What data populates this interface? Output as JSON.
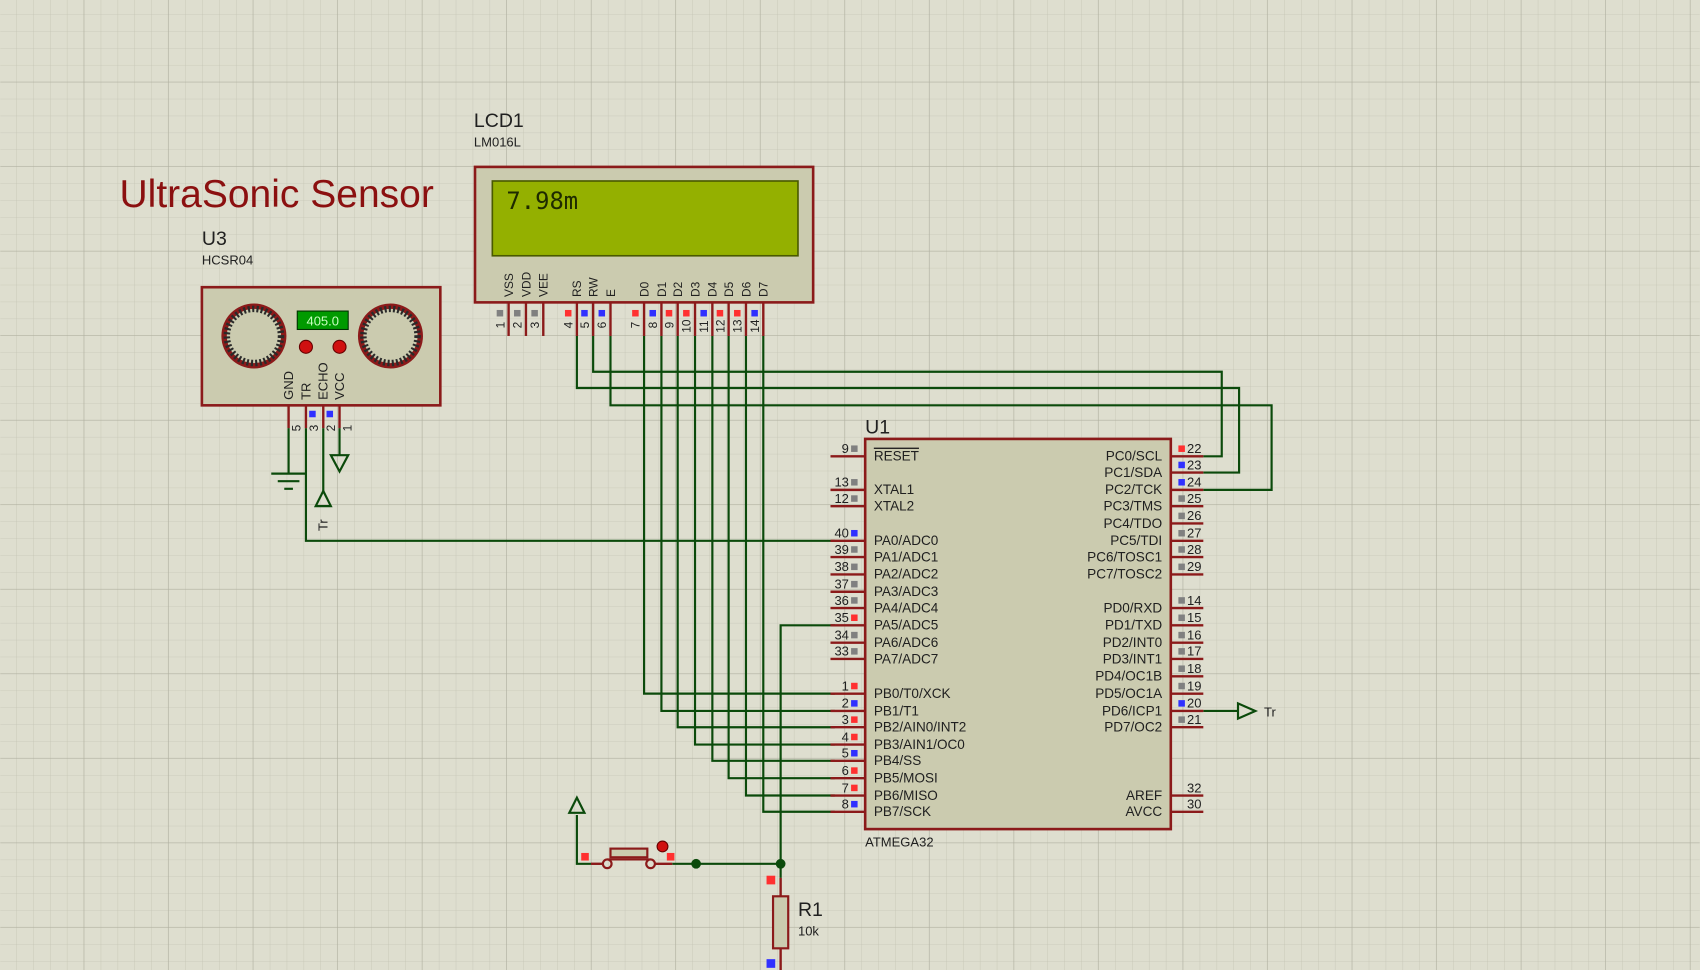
{
  "title": "UltraSonic Sensor",
  "colors": {
    "background": "#dedecf",
    "outline": "#8b1a1a",
    "wire": "#0b4a0b",
    "lcd_screen": "#94b000",
    "title": "#8b1010",
    "pin_high": "#ff3030",
    "pin_low": "#3030ff",
    "pin_float": "#808080"
  },
  "sensor": {
    "ref": "U3",
    "part": "HCSR04",
    "display_value": "405.0",
    "pins": [
      {
        "name": "GND",
        "num": "5"
      },
      {
        "name": "TR",
        "num": "3"
      },
      {
        "name": "ECHO",
        "num": "2"
      },
      {
        "name": "VCC",
        "num": "1"
      }
    ],
    "terminal_label": "Tr"
  },
  "lcd": {
    "ref": "LCD1",
    "part": "LM016L",
    "screen_text": "7.98m",
    "pins": [
      {
        "name": "VSS",
        "num": "1",
        "state": "float"
      },
      {
        "name": "VDD",
        "num": "2",
        "state": "float"
      },
      {
        "name": "VEE",
        "num": "3",
        "state": "float"
      },
      {
        "name": "RS",
        "num": "4",
        "state": "high"
      },
      {
        "name": "RW",
        "num": "5",
        "state": "low"
      },
      {
        "name": "E",
        "num": "6",
        "state": "low"
      },
      {
        "name": "D0",
        "num": "7",
        "state": "high"
      },
      {
        "name": "D1",
        "num": "8",
        "state": "low"
      },
      {
        "name": "D2",
        "num": "9",
        "state": "high"
      },
      {
        "name": "D3",
        "num": "10",
        "state": "high"
      },
      {
        "name": "D4",
        "num": "11",
        "state": "low"
      },
      {
        "name": "D5",
        "num": "12",
        "state": "high"
      },
      {
        "name": "D6",
        "num": "13",
        "state": "high"
      },
      {
        "name": "D7",
        "num": "14",
        "state": "low"
      }
    ]
  },
  "mcu": {
    "ref": "U1",
    "part": "ATMEGA32",
    "left_pins": [
      {
        "num": "9",
        "name": "RESET",
        "state": "float",
        "overline": true
      },
      {
        "num": "13",
        "name": "XTAL1",
        "state": "float"
      },
      {
        "num": "12",
        "name": "XTAL2",
        "state": "float"
      },
      {
        "num": "40",
        "name": "PA0/ADC0",
        "state": "low"
      },
      {
        "num": "39",
        "name": "PA1/ADC1",
        "state": "float"
      },
      {
        "num": "38",
        "name": "PA2/ADC2",
        "state": "float"
      },
      {
        "num": "37",
        "name": "PA3/ADC3",
        "state": "float"
      },
      {
        "num": "36",
        "name": "PA4/ADC4",
        "state": "float"
      },
      {
        "num": "35",
        "name": "PA5/ADC5",
        "state": "high"
      },
      {
        "num": "34",
        "name": "PA6/ADC6",
        "state": "float"
      },
      {
        "num": "33",
        "name": "PA7/ADC7",
        "state": "float"
      },
      {
        "num": "1",
        "name": "PB0/T0/XCK",
        "state": "high"
      },
      {
        "num": "2",
        "name": "PB1/T1",
        "state": "low"
      },
      {
        "num": "3",
        "name": "PB2/AIN0/INT2",
        "state": "high"
      },
      {
        "num": "4",
        "name": "PB3/AIN1/OC0",
        "state": "high"
      },
      {
        "num": "5",
        "name": "PB4/SS",
        "state": "low"
      },
      {
        "num": "6",
        "name": "PB5/MOSI",
        "state": "high"
      },
      {
        "num": "7",
        "name": "PB6/MISO",
        "state": "high"
      },
      {
        "num": "8",
        "name": "PB7/SCK",
        "state": "low"
      }
    ],
    "right_pins": [
      {
        "num": "22",
        "name": "PC0/SCL",
        "state": "high"
      },
      {
        "num": "23",
        "name": "PC1/SDA",
        "state": "low"
      },
      {
        "num": "24",
        "name": "PC2/TCK",
        "state": "low"
      },
      {
        "num": "25",
        "name": "PC3/TMS",
        "state": "float"
      },
      {
        "num": "26",
        "name": "PC4/TDO",
        "state": "float"
      },
      {
        "num": "27",
        "name": "PC5/TDI",
        "state": "float"
      },
      {
        "num": "28",
        "name": "PC6/TOSC1",
        "state": "float"
      },
      {
        "num": "29",
        "name": "PC7/TOSC2",
        "state": "float"
      },
      {
        "num": "14",
        "name": "PD0/RXD",
        "state": "float"
      },
      {
        "num": "15",
        "name": "PD1/TXD",
        "state": "float"
      },
      {
        "num": "16",
        "name": "PD2/INT0",
        "state": "float"
      },
      {
        "num": "17",
        "name": "PD3/INT1",
        "state": "float"
      },
      {
        "num": "18",
        "name": "PD4/OC1B",
        "state": "float"
      },
      {
        "num": "19",
        "name": "PD5/OC1A",
        "state": "float"
      },
      {
        "num": "20",
        "name": "PD6/ICP1",
        "state": "low"
      },
      {
        "num": "21",
        "name": "PD7/OC2",
        "state": "float"
      },
      {
        "num": "32",
        "name": "AREF",
        "state": "none"
      },
      {
        "num": "30",
        "name": "AVCC",
        "state": "none"
      }
    ],
    "terminal_label": "Tr"
  },
  "resistor": {
    "ref": "R1",
    "value": "10k"
  }
}
